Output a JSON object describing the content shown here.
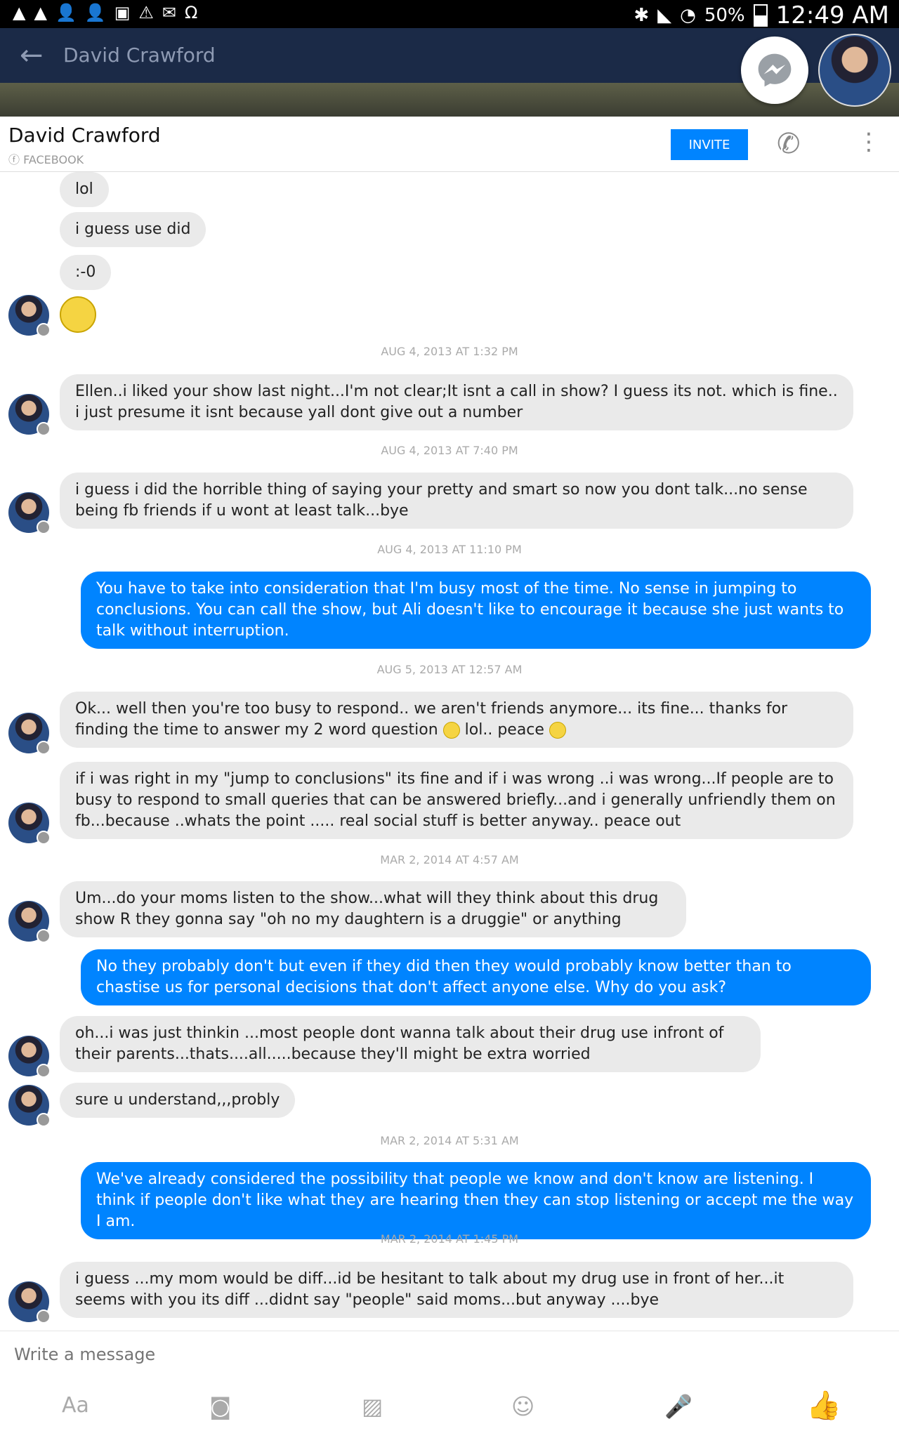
{
  "status": {
    "battery": "50%",
    "time": "12:49 AM"
  },
  "appbar": {
    "title": "David Crawford"
  },
  "header": {
    "name": "David Crawford",
    "source": "FACEBOOK",
    "invite": "INVITE"
  },
  "thread": {
    "m1": "lol",
    "m2": "i guess use did",
    "m3": ":-0",
    "ts1": "AUG 4, 2013 AT 1:32 PM",
    "m4": "Ellen..i liked your show last night...I'm not clear;It isnt a call in show?   I guess its not.  which is fine.. i just presume it isnt because yall dont give out a number",
    "ts2": "AUG 4, 2013 AT 7:40 PM",
    "m5": "i guess i did the horrible thing of saying your pretty and smart so now you dont talk...no sense being fb friends if u wont at least talk...bye",
    "ts3": "AUG 4, 2013 AT 11:10 PM",
    "m6": "You have to take into consideration that I'm busy most of the time. No sense in jumping to conclusions. You can call the show, but Ali doesn't like to encourage it because she just wants to talk without interruption.",
    "ts4": "AUG 5, 2013 AT 12:57 AM",
    "m7a": "Ok... well then you're too busy to respond..  we aren't friends anymore... its fine... thanks for finding the time to answer my 2 word question ",
    "m7b": " lol.. peace ",
    "m8": "if i  was right in my \"jump to conclusions\" its fine and if i was wrong ..i was wrong...If people are to busy to respond to small queries that can be answered briefly...and i generally unfriendly them on fb...because ..whats the point ..... real   social stuff is better anyway.. peace out",
    "ts5": "MAR 2, 2014 AT 4:57 AM",
    "m9": "Um...do your moms listen to the show...what will they think about this drug show   R they gonna say \"oh no my daughtern  is a druggie\" or anything",
    "m10": "No they probably don't but even if they did then they would probably know better than to chastise us for personal decisions that don't affect anyone else. Why do you ask?",
    "m11": "oh...i was just thinkin ...most people dont wanna talk about their drug use infront of their parents...thats....all.....because they'll might be extra worried",
    "m12": "sure u understand,,,probly",
    "ts6": "MAR 2, 2014 AT 5:31 AM",
    "m13": "We've already considered the possibility that people we know and don't know are listening. I think if people don't like what they are hearing then they can stop listening or accept me the way I am.",
    "ts7": "MAR 2, 2014 AT 1:45 PM",
    "m14": "i guess ...my mom would be diff...id be hesitant to talk about my drug use in front of her...it seems with you its diff ...didnt say \"people\" said moms...but anyway ....bye"
  },
  "compose": {
    "placeholder": "Write a message"
  },
  "toolbar": {
    "aa": "Aa"
  },
  "icons": {
    "back": "back-arrow-icon",
    "messenger": "messenger-icon",
    "phone": "phone-icon",
    "more": "more-vert-icon",
    "camera": "camera-icon",
    "gallery": "gallery-icon",
    "emoji": "emoji-icon",
    "mic": "mic-icon",
    "like": "thumbs-up-icon"
  },
  "colors": {
    "accent": "#0084ff",
    "incoming": "#eaeaea",
    "appbar": "#1b2a47"
  }
}
